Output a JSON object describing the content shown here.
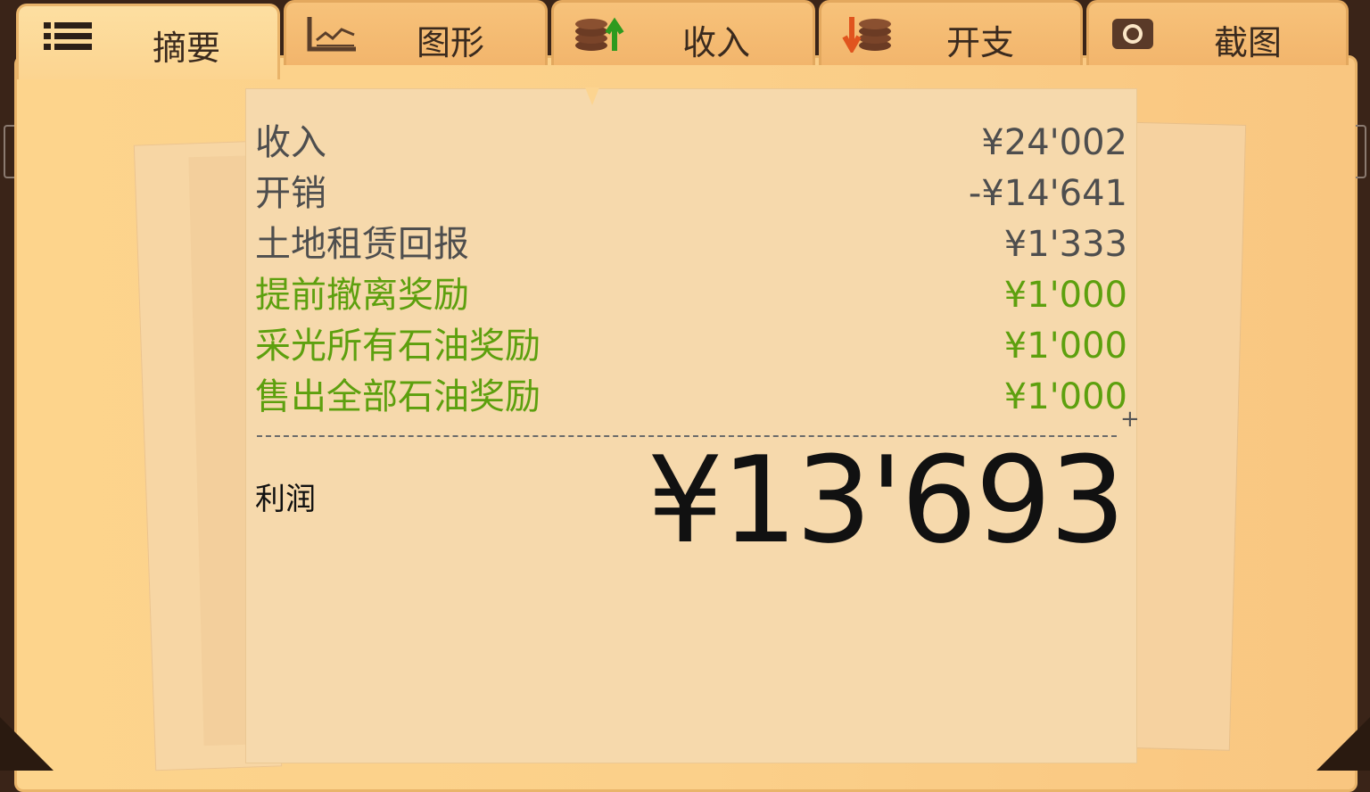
{
  "tabs": [
    {
      "label": "摘要",
      "icon": "list-icon",
      "active": true
    },
    {
      "label": "图形",
      "icon": "graph-icon",
      "active": false
    },
    {
      "label": "收入",
      "icon": "coins-up-icon",
      "active": false
    },
    {
      "label": "开支",
      "icon": "coins-down-icon",
      "active": false
    },
    {
      "label": "截图",
      "icon": "camera-icon",
      "active": false
    }
  ],
  "summary": {
    "rows": [
      {
        "label": "收入",
        "value": "¥24'002",
        "type": "normal"
      },
      {
        "label": "开销",
        "value": "-¥14'641",
        "type": "normal"
      },
      {
        "label": "土地租赁回报",
        "value": "¥1'333",
        "type": "normal"
      },
      {
        "label": "提前撤离奖励",
        "value": "¥1'000",
        "type": "bonus"
      },
      {
        "label": "采光所有石油奖励",
        "value": "¥1'000",
        "type": "bonus"
      },
      {
        "label": "售出全部石油奖励",
        "value": "¥1'000",
        "type": "bonus"
      }
    ],
    "plus_sign": "+",
    "profit_label": "利润",
    "profit_value": "¥13'693"
  },
  "colors": {
    "bonus_green": "#5da00e",
    "normal_text": "#4e4e4e",
    "background_dark": "#3a2418"
  }
}
